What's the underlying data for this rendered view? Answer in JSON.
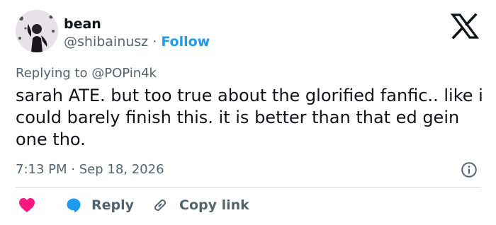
{
  "author": {
    "display_name": "bean",
    "handle": "@shibainusz",
    "separator": "·",
    "follow_label": "Follow"
  },
  "reply_context": {
    "prefix": "Replying to",
    "mention": "@POPin4k"
  },
  "tweet": {
    "text": "sarah ATE. but too true about the glorified fanfic.. like i could barely finish this. it is better than that ed gein one tho.",
    "time": "7:13 PM",
    "separator": "·",
    "date": "Sep 18, 2026"
  },
  "actions": {
    "reply_label": "Reply",
    "copy_link_label": "Copy link"
  },
  "icons": {
    "brand": "x-logo-icon",
    "info": "info-icon",
    "like": "heart-icon",
    "reply": "speech-bubble-icon",
    "copy": "link-icon"
  },
  "colors": {
    "text": "#0f1419",
    "secondary": "#536471",
    "accent": "#1d9bf0",
    "heart": "#f91880",
    "divider": "#cfd9de"
  }
}
